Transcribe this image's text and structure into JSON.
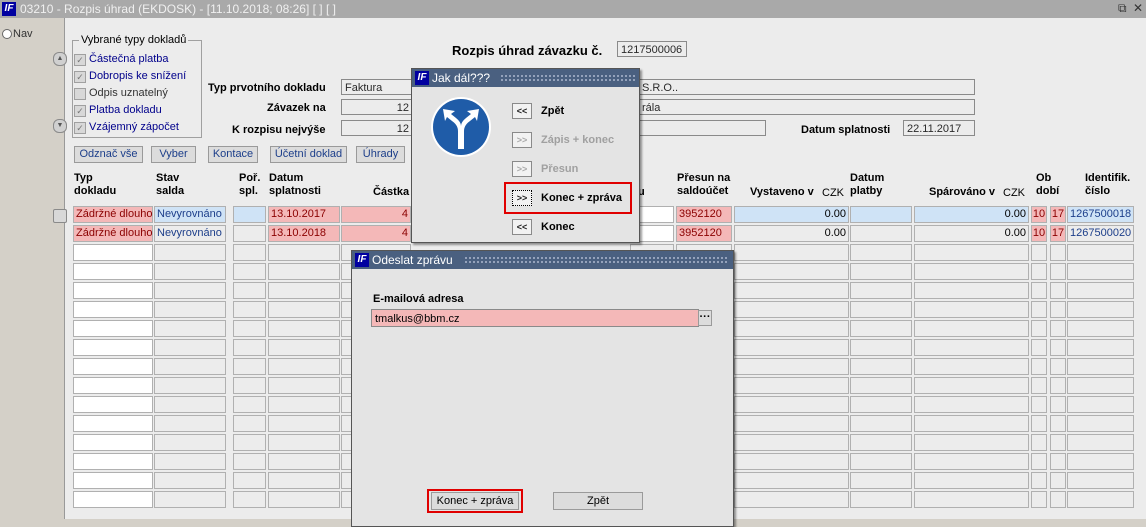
{
  "window": {
    "title": "03210 - Rozpis úhrad (EKDOSK) - [11.10.2018; 08:26]  [ ]  [ ]",
    "restore_icon": "restore-icon",
    "close_icon": "close-icon"
  },
  "left_panel": {
    "nav_label": "Nav"
  },
  "doc_types": {
    "legend": "Vybrané typy dokladů",
    "items": [
      {
        "label": "Částečná platba",
        "checked": true
      },
      {
        "label": "Dobropis ke snížení",
        "checked": true
      },
      {
        "label": "Odpis uznatelný",
        "checked": false
      },
      {
        "label": "Platba dokladu",
        "checked": true
      },
      {
        "label": "Vzájemný zápočet",
        "checked": true
      }
    ]
  },
  "header": {
    "title": "Rozpis úhrad závazku č.",
    "number": "1217500006",
    "typ_label": "Typ prvotního dokladu",
    "typ_value": "Faktura",
    "typ_right": "S.R.O..",
    "zavazek_label": "Závazek na",
    "zavazek_value": "12",
    "zavazek_right": "rála",
    "k_rozpisu_label": "K rozpisu nejvýše",
    "k_rozpisu_value": "12",
    "datum_splatnosti_label": "Datum splatnosti",
    "datum_splatnosti_value": "22.11.2017"
  },
  "toolbar": {
    "odznac": "Odznač vše",
    "vyber": "Vyber",
    "kontace": "Kontace",
    "ucetni": "Účetní doklad",
    "uhrady": "Úhrady"
  },
  "table": {
    "columns": {
      "typ": [
        "Typ",
        "dokladu"
      ],
      "stav": [
        "Stav",
        "salda"
      ],
      "por": [
        "Poř.",
        "spl."
      ],
      "datum_spl": [
        "Datum",
        "splatnosti"
      ],
      "castka": "Částka",
      "u": "u",
      "presun": [
        "Přesun na",
        "saldoúčet"
      ],
      "vystaveno": "Vystaveno v",
      "vystaveno_cur": "CZK",
      "datum_platby": [
        "Datum",
        "platby"
      ],
      "sparovano": "Spárováno v",
      "sparovano_cur": "CZK",
      "obdobi": [
        "Ob",
        "dobí"
      ],
      "ident": [
        "Identifik.",
        "číslo"
      ]
    },
    "rows": [
      {
        "typ": "Zádržné dlouho",
        "stav": "Nevyrovnáno",
        "por": "",
        "datum": "13.10.2017",
        "castka": "4",
        "presun": "3952120",
        "vystaveno": "0.00",
        "datum_platby": "",
        "sparovano": "0.00",
        "ob1": "10",
        "ob2": "17",
        "ident": "1267500018"
      },
      {
        "typ": "Zádržné dlouho",
        "stav": "Nevyrovnáno",
        "por": "",
        "datum": "13.10.2018",
        "castka": "4",
        "presun": "3952120",
        "vystaveno": "0.00",
        "datum_platby": "",
        "sparovano": "0.00",
        "ob1": "10",
        "ob2": "17",
        "ident": "1267500020"
      }
    ]
  },
  "dialog_jak": {
    "title": "Jak dál???",
    "options": [
      {
        "arrow": "<<",
        "label": "Zpět",
        "enabled": true
      },
      {
        "arrow": ">>",
        "label": "Zápis + konec",
        "enabled": false
      },
      {
        "arrow": ">>",
        "label": "Přesun",
        "enabled": false
      },
      {
        "arrow": ">>",
        "label": "Konec + zpráva",
        "enabled": true
      },
      {
        "arrow": "<<",
        "label": "Konec",
        "enabled": true
      }
    ],
    "sign_icon": "road-fork-sign-icon"
  },
  "dialog_email": {
    "title": "Odeslat zprávu",
    "email_label": "E-mailová adresa",
    "email_value": "tmalkus@bbm.cz",
    "lookup_label": "···",
    "konec_zprava": "Konec + zpráva",
    "zpet": "Zpět"
  },
  "colors": {
    "pink": "#f4b8b8",
    "blue": "#cfe3f6",
    "dialog_title": "#4a6080",
    "highlight": "#e00000"
  }
}
